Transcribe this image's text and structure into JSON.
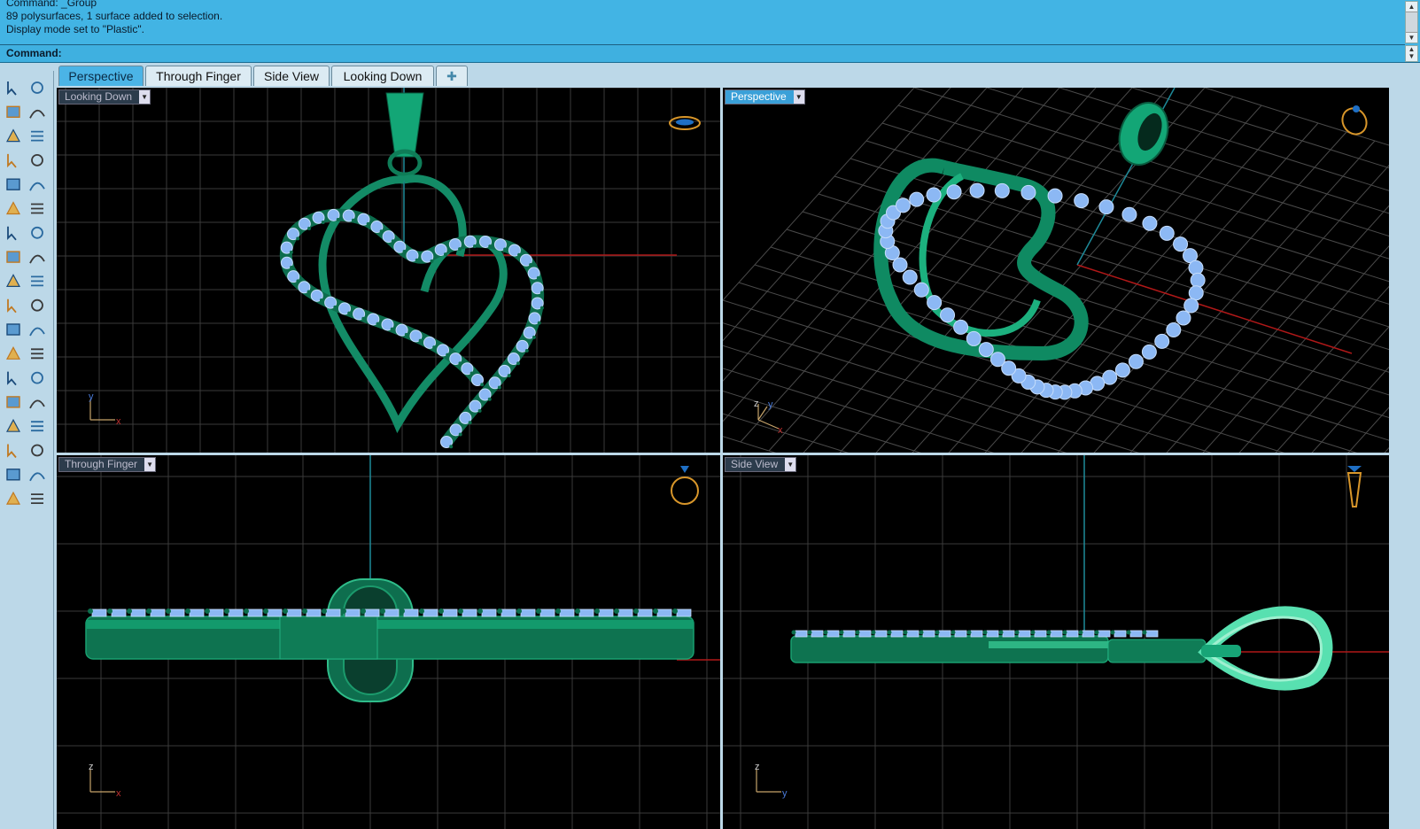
{
  "command_history": [
    "Command: _Group",
    "89 polysurfaces, 1 surface added to selection.",
    "Display mode set to \"Plastic\"."
  ],
  "command_prompt": "Command:",
  "scroll_icons": [
    "scroll-up-icon",
    "scroll-down-icon"
  ],
  "tabs": [
    {
      "label": "Perspective",
      "active": true
    },
    {
      "label": "Through Finger",
      "active": false
    },
    {
      "label": "Side View",
      "active": false
    },
    {
      "label": "Looking Down",
      "active": false
    }
  ],
  "add_tab_icon": "plus-icon",
  "viewports": {
    "looking_down": {
      "label": "Looking Down",
      "axes": {
        "h": "x",
        "v": "y"
      }
    },
    "perspective": {
      "label": "Perspective",
      "active": true,
      "axes": {
        "h": "x",
        "v": "y",
        "up": "z"
      }
    },
    "through_finger": {
      "label": "Through Finger",
      "axes": {
        "h": "x",
        "v": "z"
      }
    },
    "side_view": {
      "label": "Side View",
      "axes": {
        "h": "y",
        "v": "z"
      }
    }
  },
  "toolbar_icons": [
    "select-icon",
    "point-icon",
    "polyline-icon",
    "curve-icon",
    "circle-icon",
    "ellipse-icon",
    "arc-icon",
    "rectangle-icon",
    "polygon-icon",
    "fillet-curve-icon",
    "surface-icon",
    "extrude-surface-icon",
    "box-icon",
    "sphere-icon",
    "cylinder-icon",
    "loft-icon",
    "boolean-icon",
    "explode-icon",
    "trim-icon",
    "split-icon",
    "group-icon",
    "ungroup-icon",
    "fillet-edge-icon",
    "offset-icon",
    "text-icon",
    "scale-icon",
    "array-icon",
    "mirror-icon",
    "solid-icon",
    "dimension-icon",
    "grid-snap-icon",
    "layer-icon",
    "render-icon",
    "check-icon",
    "shade-icon",
    "paint-icon"
  ],
  "colors": {
    "command_bg": "#42b4e4",
    "viewport_bg": "#000000",
    "model": "#129068",
    "gems": "#8cb8f4",
    "x_axis": "#c02020",
    "y_axis": "#20a0b0"
  }
}
